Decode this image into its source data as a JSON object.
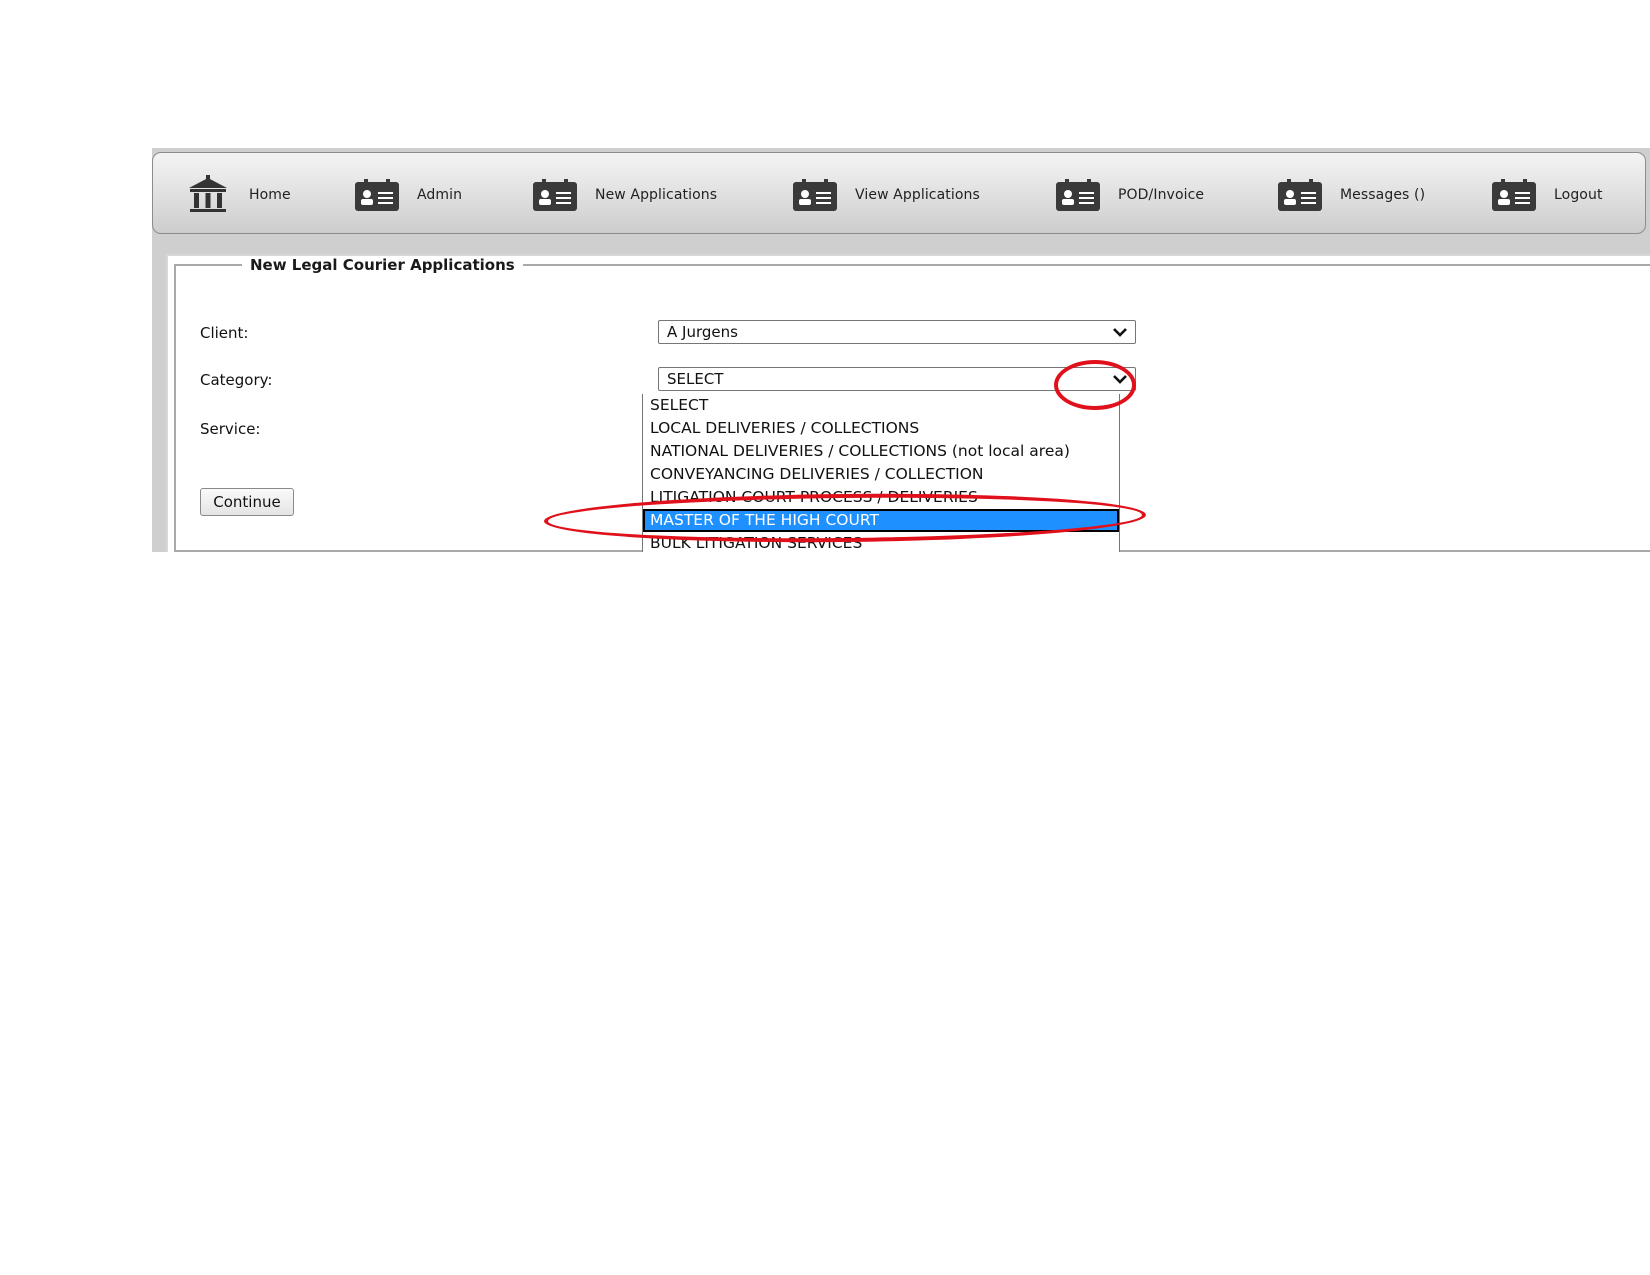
{
  "nav": {
    "items": [
      {
        "label": "Home",
        "icon": "bank-icon"
      },
      {
        "label": "Admin",
        "icon": "id-card-icon"
      },
      {
        "label": "New Applications",
        "icon": "id-card-icon"
      },
      {
        "label": "View Applications",
        "icon": "id-card-icon"
      },
      {
        "label": "POD/Invoice",
        "icon": "id-card-icon"
      },
      {
        "label": "Messages ()",
        "icon": "id-card-icon"
      },
      {
        "label": "Logout",
        "icon": "id-card-icon"
      }
    ]
  },
  "form": {
    "legend": "New Legal Courier Applications",
    "client_label": "Client:",
    "client_value": "A Jurgens",
    "category_label": "Category:",
    "category_value": "SELECT",
    "service_label": "Service:",
    "continue_label": "Continue"
  },
  "category_options": [
    "SELECT",
    "LOCAL DELIVERIES / COLLECTIONS",
    "NATIONAL DELIVERIES / COLLECTIONS (not local area)",
    "CONVEYANCING DELIVERIES / COLLECTION",
    "LITIGATION COURT PROCESS / DELIVERIES",
    "MASTER OF THE HIGH COURT",
    "BULK LITIGATION SERVICES"
  ],
  "selected_option": "MASTER OF THE HIGH COURT",
  "colors": {
    "highlight": "#1e90ff",
    "annotation": "#e0111b"
  }
}
